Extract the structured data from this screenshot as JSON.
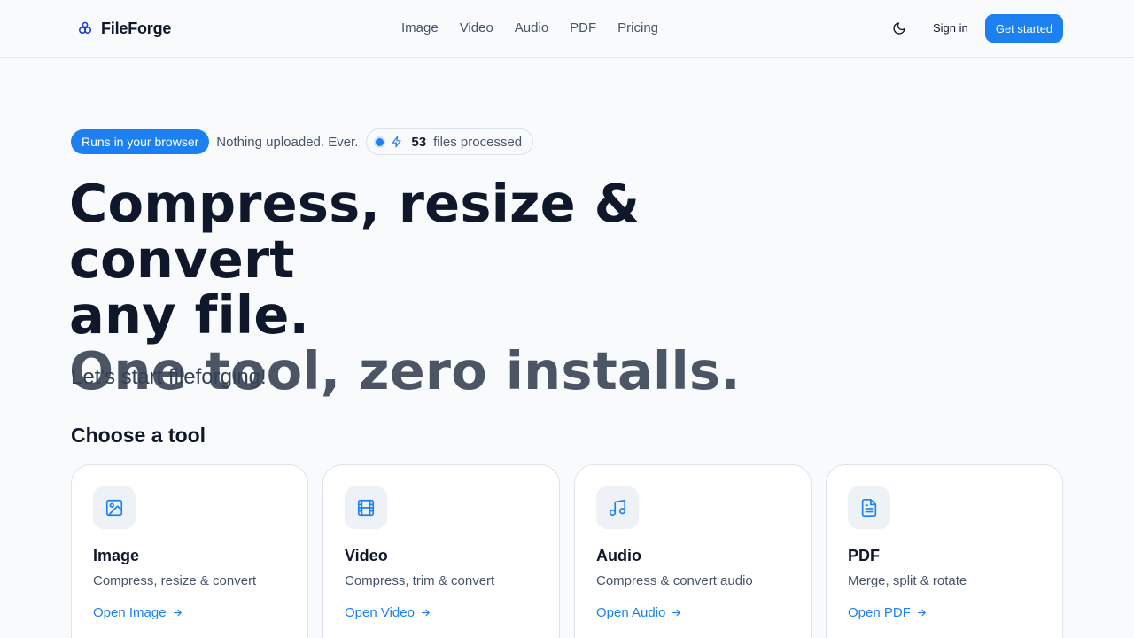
{
  "brand": {
    "name": "FileForge",
    "accent": "#1d80f0"
  },
  "nav": {
    "items": [
      "Image",
      "Video",
      "Audio",
      "PDF",
      "Pricing"
    ]
  },
  "header": {
    "signin": "Sign in",
    "cta": "Get started",
    "theme_icon": "moon-icon"
  },
  "badges": {
    "pill": "Runs in your browser",
    "note": "Nothing uploaded. Ever.",
    "count": "53",
    "count_label": "files processed"
  },
  "hero": {
    "line1": "Compress, resize & convert",
    "line2": "any file.",
    "line3": "One tool, zero installs.",
    "sub": "Let's start fileforging!"
  },
  "tools": {
    "title": "Choose a tool",
    "cards": [
      {
        "icon": "image-icon",
        "title": "Image",
        "desc": "Compress, resize & convert",
        "link": "Open Image"
      },
      {
        "icon": "film-icon",
        "title": "Video",
        "desc": "Compress, trim & convert",
        "link": "Open Video"
      },
      {
        "icon": "music-icon",
        "title": "Audio",
        "desc": "Compress & convert audio",
        "link": "Open Audio"
      },
      {
        "icon": "file-text-icon",
        "title": "PDF",
        "desc": "Merge, split & rotate",
        "link": "Open PDF"
      }
    ]
  }
}
